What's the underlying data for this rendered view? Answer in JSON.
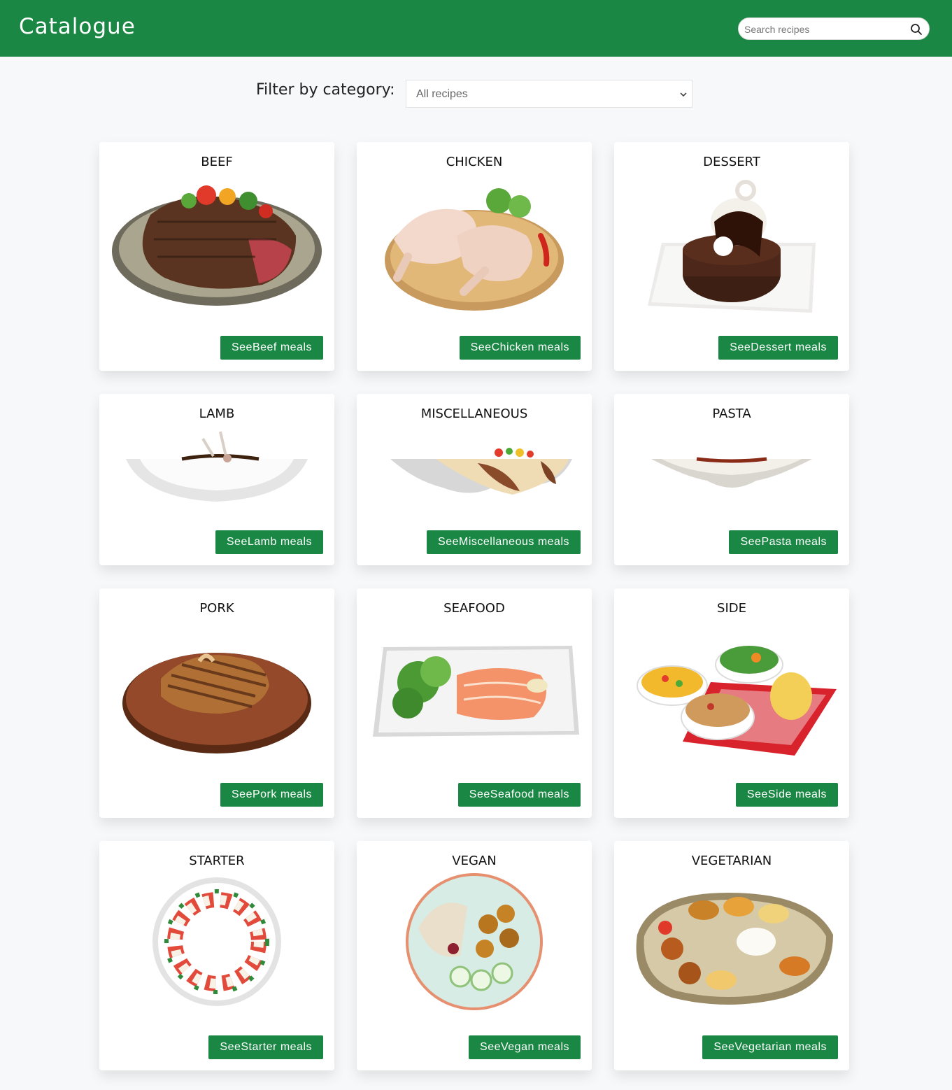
{
  "header": {
    "brand": "Catalogue",
    "search": {
      "placeholder": "Search recipes",
      "value": ""
    },
    "search_icon": "search-icon"
  },
  "filter": {
    "label": "Filter by category:",
    "selected": "All recipes"
  },
  "colors": {
    "primary": "#1a8844",
    "background": "#f7f8fa",
    "card": "#ffffff"
  },
  "categories": [
    {
      "title": "BEEF",
      "button": "SeeBeef meals",
      "image": "steak-plate"
    },
    {
      "title": "CHICKEN",
      "button": "SeeChicken meals",
      "image": "raw-chicken-board"
    },
    {
      "title": "DESSERT",
      "button": "SeeDessert meals",
      "image": "chocolate-cake"
    },
    {
      "title": "LAMB",
      "button": "SeeLamb meals",
      "image": "lamb-plate"
    },
    {
      "title": "MISCELLANEOUS",
      "button": "SeeMiscellaneous meals",
      "image": "wrap"
    },
    {
      "title": "PASTA",
      "button": "SeePasta meals",
      "image": "pasta-bowl"
    },
    {
      "title": "PORK",
      "button": "SeePork meals",
      "image": "pork-chop-board"
    },
    {
      "title": "SEAFOOD",
      "button": "SeeSeafood meals",
      "image": "salmon-plate"
    },
    {
      "title": "SIDE",
      "button": "SeeSide meals",
      "image": "side-bowls"
    },
    {
      "title": "STARTER",
      "button": "SeeStarter meals",
      "image": "caprese-plate"
    },
    {
      "title": "VEGAN",
      "button": "SeeVegan meals",
      "image": "vegan-bowl"
    },
    {
      "title": "VEGETARIAN",
      "button": "SeeVegetarian meals",
      "image": "thali-platter"
    }
  ]
}
